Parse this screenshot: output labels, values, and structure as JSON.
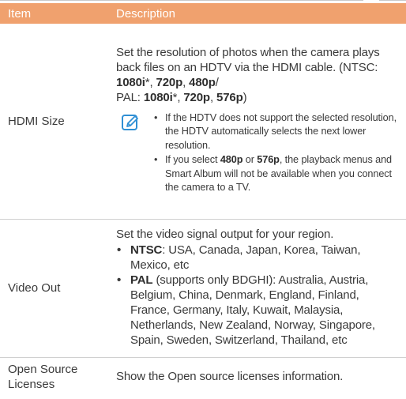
{
  "header": {
    "item": "Item",
    "description": "Description"
  },
  "colors": {
    "header_bg": "#f0a16e",
    "header_text": "#ffffff",
    "body_text": "#3a3a3a",
    "divider": "#d0d0d0",
    "note_icon": "#2f8fd4"
  },
  "rows": [
    {
      "item": "HDMI Size",
      "desc": {
        "p1": "Set the resolution of photos when the camera plays back files on an HDTV via the HDMI cable.",
        "ntsc_open": "(NTSC: ",
        "ntsc_1080": "1080i",
        "star": "*",
        "sep": ", ",
        "ntsc_720": "720p",
        "ntsc_480": "480p",
        "slash": "/",
        "pal_prefix": "PAL: ",
        "pal_1080": "1080i",
        "pal_720": "720p",
        "pal_576": "576p",
        "close": ")"
      },
      "note_icon": "note-icon",
      "notes": {
        "n1": "If the HDTV does not support the selected resolution, the HDTV automatically selects the next lower resolution.",
        "n2_a": "If you select ",
        "n2_480": "480p",
        "n2_or": " or ",
        "n2_576": "576p",
        "n2_b": ", the playback menus and Smart Album will not be available when you connect the camera to a TV."
      }
    },
    {
      "item": "Video Out",
      "desc": "Set the video signal output for your region.",
      "bullets": [
        {
          "term": "NTSC",
          "text": ": USA, Canada, Japan, Korea, Taiwan, Mexico, etc"
        },
        {
          "term": "PAL",
          "text": " (supports only BDGHI): Australia, Austria, Belgium, China, Denmark, England, Finland, France, Germany, Italy, Kuwait, Malaysia, Netherlands, New Zealand, Norway, Singapore, Spain, Sweden, Switzerland, Thailand, etc"
        }
      ]
    },
    {
      "item_line1": "Open Source",
      "item_line2": "Licenses",
      "desc": "Show the Open source licenses information."
    }
  ]
}
